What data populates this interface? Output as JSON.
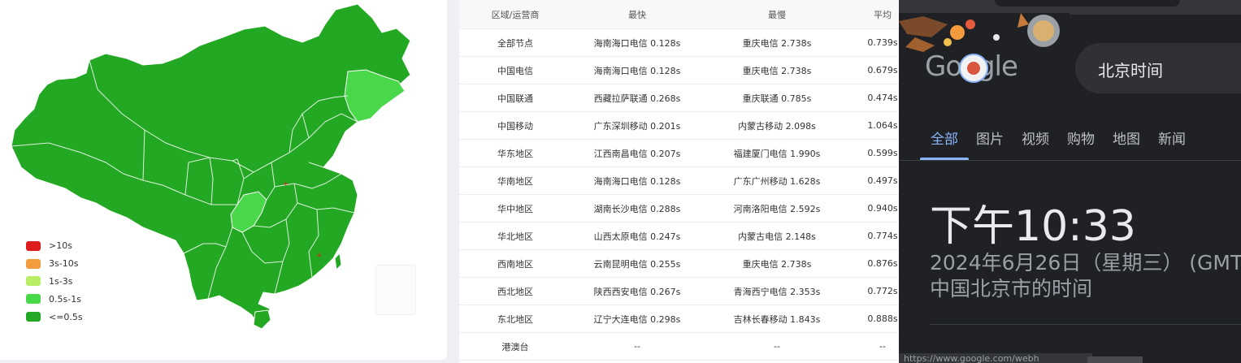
{
  "legend": [
    {
      "label": ">10s",
      "color": "#dd1d1d"
    },
    {
      "label": "3s-10s",
      "color": "#f39c3d"
    },
    {
      "label": "1s-3s",
      "color": "#b7ee65"
    },
    {
      "label": "0.5s-1s",
      "color": "#49d849"
    },
    {
      "label": "<=0.5s",
      "color": "#22a822"
    }
  ],
  "map_colors": {
    "fast": "#22a822",
    "medium": "#49d849",
    "marker": "#dd1d1d"
  },
  "table": {
    "headers": [
      "区域/运营商",
      "最快",
      "最慢",
      "平均"
    ],
    "rows": [
      [
        "全部节点",
        "海南海口电信 0.128s",
        "重庆电信 2.738s",
        "0.739s"
      ],
      [
        "中国电信",
        "海南海口电信 0.128s",
        "重庆电信 2.738s",
        "0.679s"
      ],
      [
        "中国联通",
        "西藏拉萨联通 0.268s",
        "重庆联通 0.785s",
        "0.474s"
      ],
      [
        "中国移动",
        "广东深圳移动 0.201s",
        "内蒙古移动 2.098s",
        "1.064s"
      ],
      [
        "华东地区",
        "江西南昌电信 0.207s",
        "福建厦门电信 1.990s",
        "0.599s"
      ],
      [
        "华南地区",
        "海南海口电信 0.128s",
        "广东广州移动 1.628s",
        "0.497s"
      ],
      [
        "华中地区",
        "湖南长沙电信 0.288s",
        "河南洛阳电信 2.592s",
        "0.940s"
      ],
      [
        "华北地区",
        "山西太原电信 0.247s",
        "内蒙古电信 2.148s",
        "0.774s"
      ],
      [
        "西南地区",
        "云南昆明电信 0.255s",
        "重庆电信 2.738s",
        "0.876s"
      ],
      [
        "西北地区",
        "陕西西安电信 0.267s",
        "青海西宁电信 2.353s",
        "0.772s"
      ],
      [
        "东北地区",
        "辽宁大连电信 0.298s",
        "吉林长春移动 1.843s",
        "0.888s"
      ],
      [
        "港澳台",
        "--",
        "--",
        "--"
      ]
    ]
  },
  "google": {
    "logo": "Google",
    "search_value": "北京时间",
    "tabs": [
      "全部",
      "图片",
      "视频",
      "购物",
      "地图",
      "新闻"
    ],
    "active_tab": 0,
    "time": "下午10:33",
    "date": "2024年6月26日（星期三） (GMT",
    "location": "中国北京市的时间",
    "status_url": "https://www.google.com/webh"
  }
}
